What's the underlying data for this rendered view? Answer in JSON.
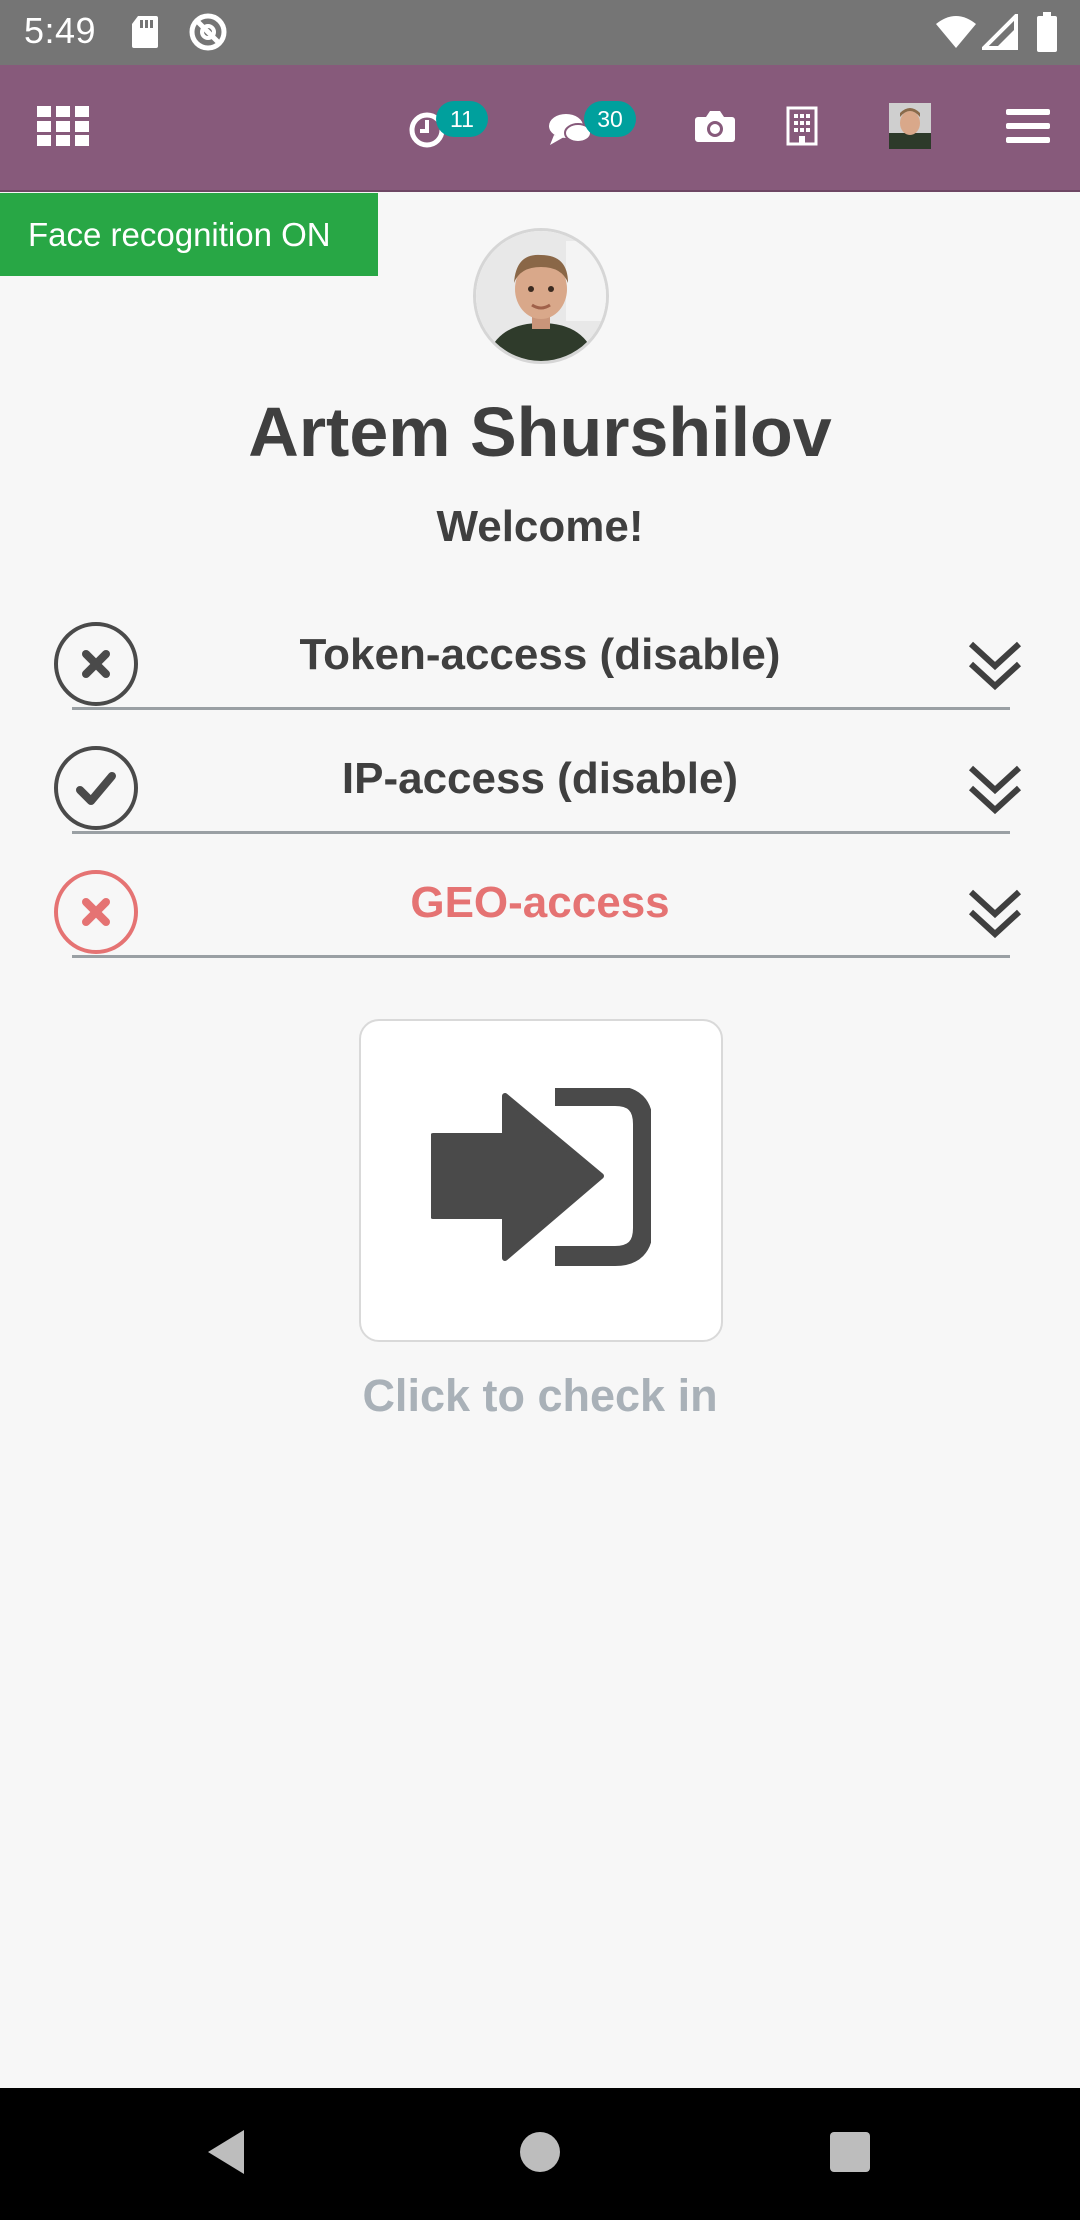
{
  "status_bar": {
    "time": "5:49",
    "left_icons": [
      "sd-card-icon",
      "do-not-disturb-icon"
    ],
    "right_icons": [
      "wifi-icon",
      "cellular-signal-icon",
      "battery-icon"
    ]
  },
  "topbar": {
    "apps_icon": "grid-icon",
    "activities_badge": "11",
    "messages_badge": "30",
    "icons": [
      "clock-icon",
      "chat-icon",
      "camera-icon",
      "building-icon",
      "avatar",
      "hamburger-menu-icon"
    ]
  },
  "banner": {
    "face_recognition": "Face recognition ON"
  },
  "profile": {
    "name": "Artem Shurshilov",
    "greeting": "Welcome!"
  },
  "access_checks": [
    {
      "label": "Token-access (disable)",
      "status": "fail",
      "icon": "x-circle-icon"
    },
    {
      "label": "IP-access (disable)",
      "status": "ok",
      "icon": "check-circle-icon"
    },
    {
      "label": "GEO-access",
      "status": "error",
      "icon": "x-circle-icon"
    }
  ],
  "checkin": {
    "caption": "Click to check in",
    "icon": "sign-in-icon"
  },
  "colors": {
    "brand": "#875a7b",
    "badge": "#00a09d",
    "success_banner": "#28a745",
    "error": "#e57373",
    "text": "#3f3f3f",
    "muted": "#a9b1b8"
  },
  "android_nav": [
    "back-icon",
    "home-icon",
    "recents-icon"
  ]
}
